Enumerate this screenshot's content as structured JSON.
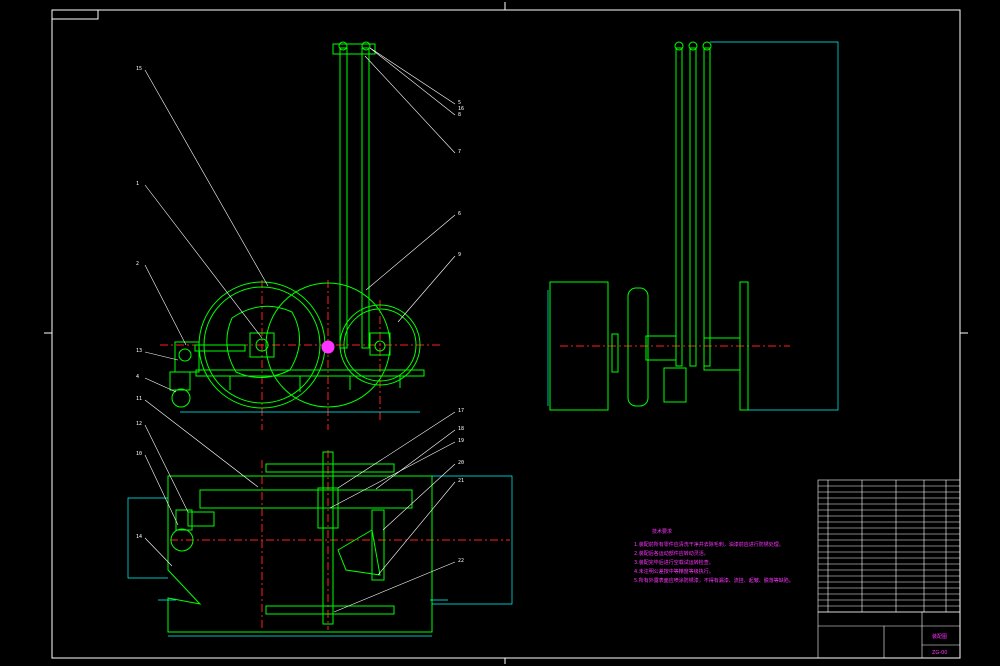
{
  "drawing": {
    "colors": {
      "background": "#000000",
      "frame": "#ffffff",
      "part": "#00ff00",
      "centerline": "#ff2020",
      "dimension": "#00ffff",
      "annotation": "#ff33ff",
      "leader": "#ffffff"
    },
    "view_elevation": {
      "callouts": [
        "15",
        "1",
        "2",
        "13",
        "4",
        "5",
        "16",
        "8",
        "7",
        "6",
        "9"
      ]
    },
    "view_plan": {
      "callouts": [
        "11",
        "12",
        "10",
        "14",
        "17",
        "18",
        "19",
        "20",
        "21",
        "22"
      ]
    },
    "tech_notes": {
      "title": "技术要求",
      "lines": [
        "1.装配前所有零件应清洗干净并去除毛刺，油漆前应进行防锈处理。",
        "2.装配后各运动部件应转动灵活。",
        "3.装配完毕后进行空载试运转检查。",
        "4.未注明公差按中等精度等级执行。",
        "5.所有外露表面应喷涂防锈漆，不得有漏漆、流挂、起皱、脱落等缺陷。"
      ]
    },
    "title_block": {
      "drawing_title": "装配图",
      "drawing_number": "ZG-00"
    }
  }
}
